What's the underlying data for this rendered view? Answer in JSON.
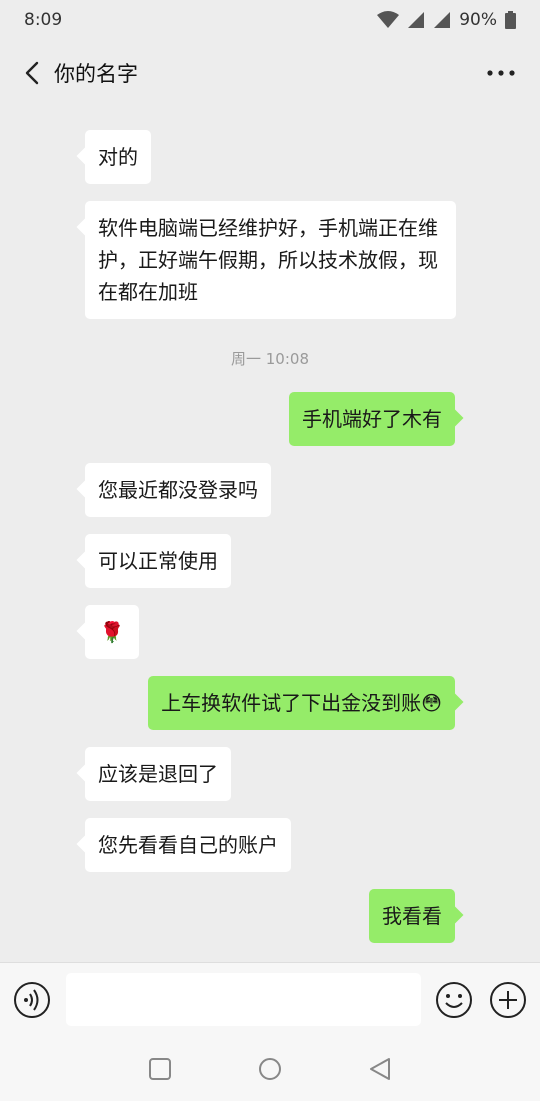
{
  "status_bar": {
    "time": "8:09",
    "battery": "90%"
  },
  "header": {
    "title": "你的名字",
    "back_icon": "chevron-left-icon",
    "more_icon": "more-dots-icon"
  },
  "messages": [
    {
      "direction": "in",
      "text": "对的"
    },
    {
      "direction": "in",
      "text": "软件电脑端已经维护好，手机端正在维护，正好端午假期，所以技术放假，现在都在加班"
    },
    {
      "type": "time",
      "text": "周一 10:08"
    },
    {
      "direction": "out",
      "text": "手机端好了木有"
    },
    {
      "direction": "in",
      "text": "您最近都没登录吗"
    },
    {
      "direction": "in",
      "text": "可以正常使用"
    },
    {
      "direction": "in",
      "text": "🌹"
    },
    {
      "direction": "out",
      "text": "上车换软件试了下出金没到账😳"
    },
    {
      "direction": "in",
      "text": "应该是退回了"
    },
    {
      "direction": "in",
      "text": "您先看看自己的账户"
    },
    {
      "direction": "out",
      "text": "我看看"
    }
  ],
  "input_bar": {
    "voice_icon": "voice-icon",
    "emoji_icon": "emoji-icon",
    "plus_icon": "plus-icon",
    "value": ""
  },
  "android_nav": {
    "icons": [
      "recent-apps-icon",
      "home-icon",
      "back-triangle-icon"
    ]
  },
  "colors": {
    "background": "#ededed",
    "bubble_out": "#95ec69",
    "bubble_in": "#ffffff"
  }
}
